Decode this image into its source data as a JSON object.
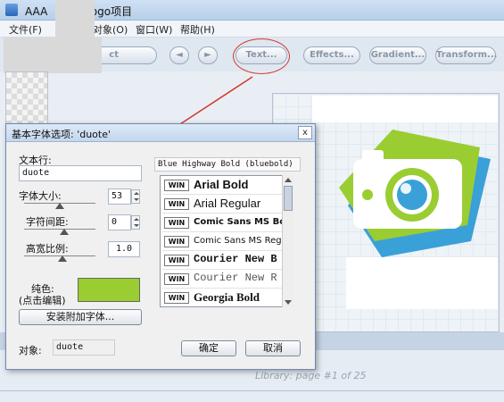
{
  "window": {
    "title": "AAA",
    "title_suffix": "Logo项目"
  },
  "menu": [
    "文件(F)",
    "对象(O)",
    "窗口(W)",
    "帮助(H)"
  ],
  "toolbar": {
    "buttons": [
      "Text...",
      "Effects...",
      "Gradient...",
      "Transform..."
    ],
    "nav_prev": "◄",
    "nav_next": "►",
    "partial_label": "ct"
  },
  "dialog": {
    "title": "基本字体选项: 'duote'",
    "close": "x",
    "text_row_label": "文本行:",
    "text_row_value": "duote",
    "font_size_label": "字体大小:",
    "font_size_value": "53",
    "char_spacing_label": "字符间距:",
    "char_spacing_value": "0",
    "aspect_label": "高宽比例:",
    "aspect_value": "1.0",
    "color_label_line1": "纯色:",
    "color_label_line2": "(点击编辑)",
    "color_value": "#9acd32",
    "install_fonts_button": "安装附加字体...",
    "object_label": "对象:",
    "object_value": "duote",
    "ok_button": "确定",
    "cancel_button": "取消",
    "current_font": "Blue Highway Bold (bluebold)",
    "fonts": [
      {
        "badge": "WIN",
        "name": "Arial Bold"
      },
      {
        "badge": "WIN",
        "name": "Arial Regular"
      },
      {
        "badge": "WIN",
        "name": "Comic Sans MS Bo"
      },
      {
        "badge": "WIN",
        "name": "Comic Sans MS Regu"
      },
      {
        "badge": "WIN",
        "name": "Courier New B"
      },
      {
        "badge": "WIN",
        "name": "Courier New R"
      },
      {
        "badge": "WIN",
        "name": "Georgia Bold"
      }
    ]
  },
  "status": {
    "library": "Library: page #1 of 25"
  },
  "colors": {
    "highlight": "#d23a2a",
    "accent_green": "#9acd32",
    "logo_blue": "#3aa0d8"
  }
}
